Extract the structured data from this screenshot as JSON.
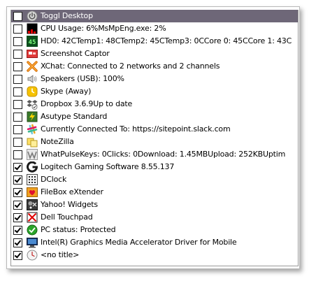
{
  "colors": {
    "selection_background": "#6e6778",
    "selection_text": "#ffffff"
  },
  "items": [
    {
      "label": "Toggl Desktop",
      "checked": false,
      "selected": true,
      "icon": "toggl-power-icon"
    },
    {
      "label": "CPU Usage: 6%MsMpEng.exe: 2%",
      "checked": false,
      "icon": "cpu-meter-icon"
    },
    {
      "label": "HD0: 42CTemp1: 48CTemp2: 45CTemp3: 0CCore 0: 45CCore 1: 43C",
      "checked": false,
      "icon": "temperature-readout-icon",
      "icon_text": "45"
    },
    {
      "label": "Screenshot Captor",
      "checked": false,
      "icon": "screenshot-captor-icon"
    },
    {
      "label": "XChat: Connected to 2 networks and 2 channels",
      "checked": false,
      "icon": "xchat-icon"
    },
    {
      "label": "Speakers (USB): 100%",
      "checked": false,
      "icon": "speaker-icon"
    },
    {
      "label": "Skype (Away)",
      "checked": false,
      "icon": "skype-away-icon"
    },
    {
      "label": "Dropbox 3.6.9Up to date",
      "checked": false,
      "icon": "dropbox-icon"
    },
    {
      "label": "Asutype Standard",
      "checked": false,
      "icon": "asutype-icon"
    },
    {
      "label": "Currently Connected To: https://sitepoint.slack.com",
      "checked": false,
      "icon": "slack-icon"
    },
    {
      "label": "NoteZilla",
      "checked": false,
      "icon": "notezilla-icon"
    },
    {
      "label": "WhatPulseKeys: 0Clicks: 0Download: 1.45MBUpload: 252KBUptim",
      "checked": false,
      "icon": "whatpulse-icon"
    },
    {
      "label": "Logitech Gaming Software 8.55.137",
      "checked": true,
      "icon": "logitech-g-icon"
    },
    {
      "label": "DClock",
      "checked": true,
      "icon": "dclock-icon"
    },
    {
      "label": "FileBox eXtender",
      "checked": true,
      "icon": "filebox-extender-icon"
    },
    {
      "label": "Yahoo! Widgets",
      "checked": true,
      "icon": "yahoo-widgets-icon"
    },
    {
      "label": "Dell Touchpad",
      "checked": true,
      "icon": "dell-touchpad-icon"
    },
    {
      "label": "PC status: Protected",
      "checked": true,
      "icon": "pc-status-shield-icon"
    },
    {
      "label": "Intel(R) Graphics Media Accelerator Driver for Mobile",
      "checked": true,
      "icon": "intel-graphics-icon"
    },
    {
      "label": "<no title>",
      "checked": true,
      "icon": "clock-icon"
    }
  ]
}
